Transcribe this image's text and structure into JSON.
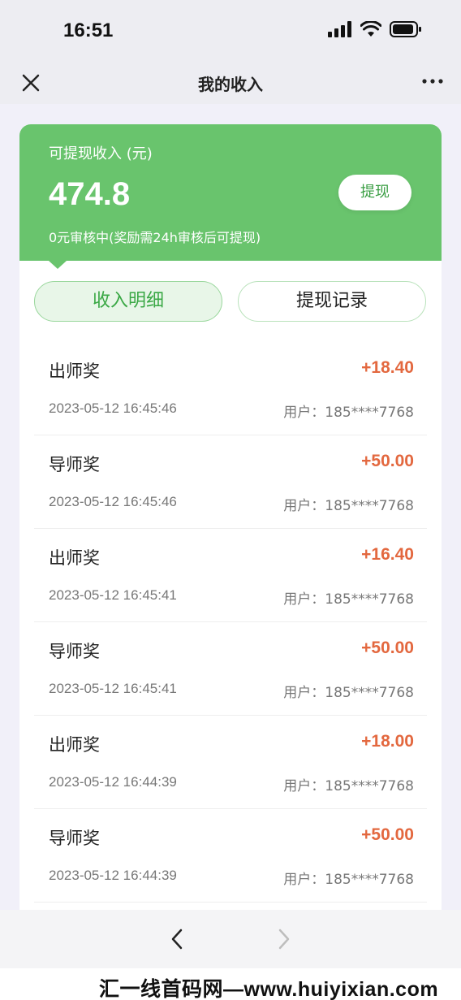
{
  "status": {
    "time": "16:51"
  },
  "nav": {
    "title": "我的收入",
    "close_icon": "close-icon",
    "more_icon": "more-icon"
  },
  "summary": {
    "label": "可提现收入 (元)",
    "amount": "474.8",
    "note": "0元审核中(奖励需24h审核后可提现)",
    "withdraw_label": "提现"
  },
  "tabs": [
    {
      "label": "收入明细",
      "active": true
    },
    {
      "label": "提现记录",
      "active": false
    }
  ],
  "records": [
    {
      "title": "出师奖",
      "amount": "+18.40",
      "time": "2023-05-12 16:45:46",
      "user": "用户：185****7768"
    },
    {
      "title": "导师奖",
      "amount": "+50.00",
      "time": "2023-05-12 16:45:46",
      "user": "用户：185****7768"
    },
    {
      "title": "出师奖",
      "amount": "+16.40",
      "time": "2023-05-12 16:45:41",
      "user": "用户：185****7768"
    },
    {
      "title": "导师奖",
      "amount": "+50.00",
      "time": "2023-05-12 16:45:41",
      "user": "用户：185****7768"
    },
    {
      "title": "出师奖",
      "amount": "+18.00",
      "time": "2023-05-12 16:44:39",
      "user": "用户：185****7768"
    },
    {
      "title": "导师奖",
      "amount": "+50.00",
      "time": "2023-05-12 16:44:39",
      "user": "用户：185****7768"
    }
  ],
  "watermark": "汇一线首码网—www.huiyixian.com",
  "colors": {
    "header_green": "#69c46d",
    "amount_orange": "#e3683f",
    "tab_active_text": "#3aa845"
  }
}
